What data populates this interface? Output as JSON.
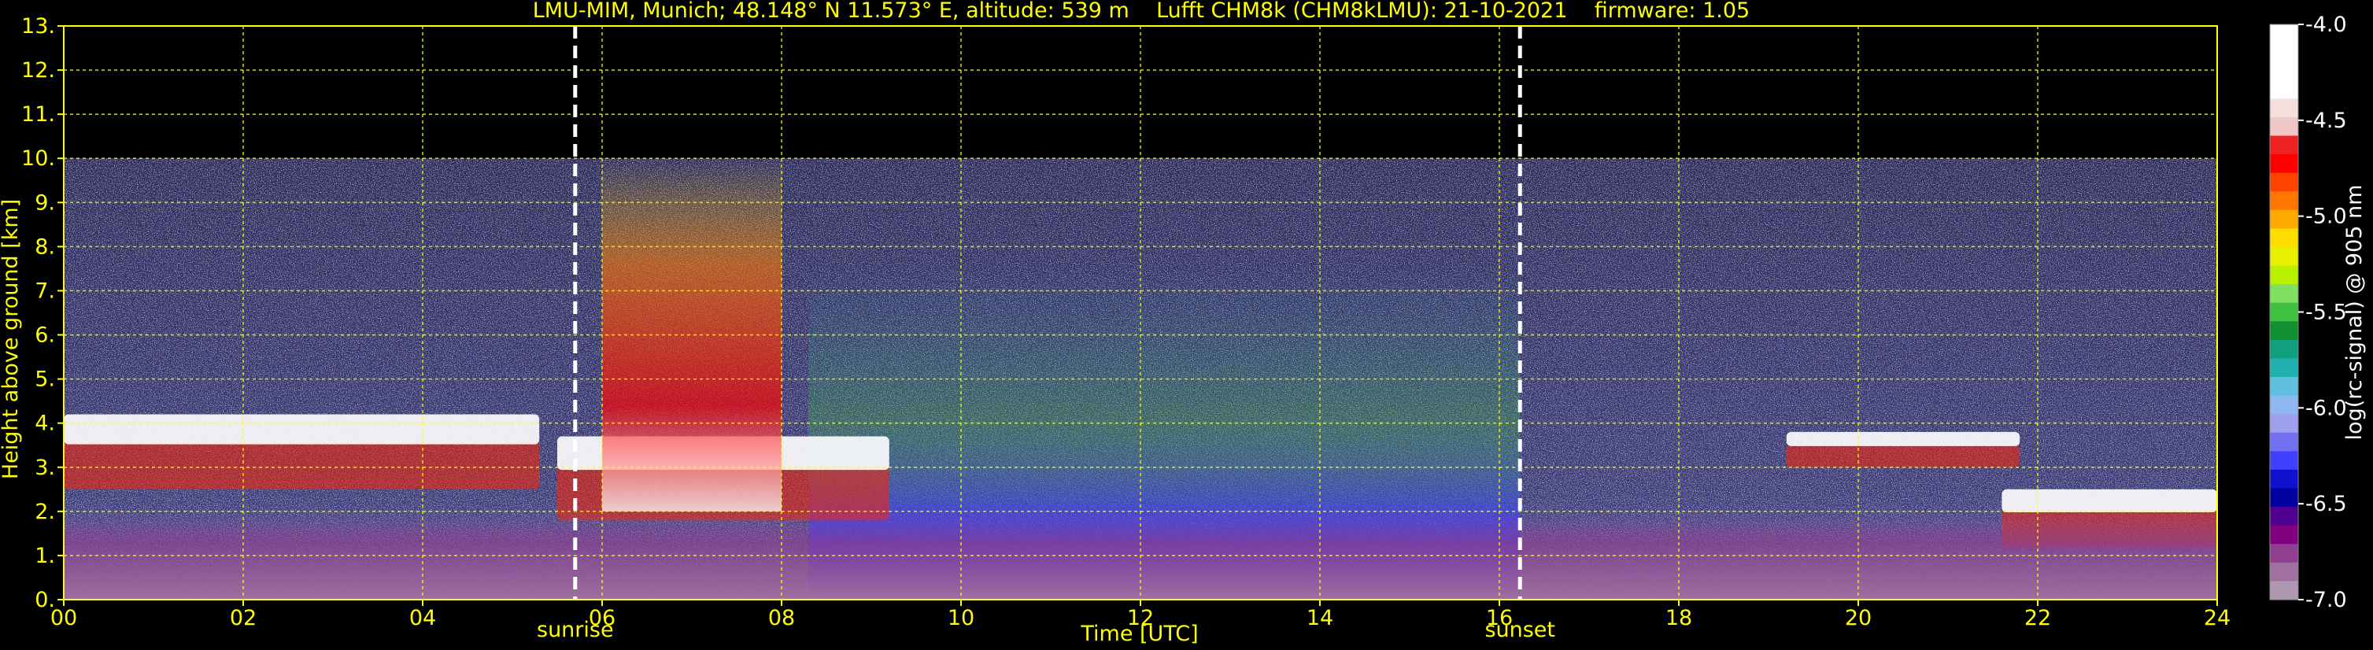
{
  "chart_data": {
    "type": "heatmap",
    "title": "LMU-MIM, Munich; 48.148° N 11.573° E, altitude: 539 m    Lufft CHM8k (CHM8kLMU): 21-10-2021    firmware: 1.05",
    "xlabel": "Time [UTC]",
    "ylabel": "Height above ground [km]",
    "xlim": [
      0,
      24
    ],
    "ylim": [
      0,
      13
    ],
    "x_ticks": [
      "00",
      "02",
      "04",
      "06",
      "08",
      "10",
      "12",
      "14",
      "16",
      "18",
      "20",
      "22",
      "24"
    ],
    "y_ticks": [
      "0.",
      "1.",
      "2.",
      "3.",
      "4.",
      "5.",
      "6.",
      "7.",
      "8.",
      "9.",
      "10.",
      "11.",
      "12.",
      "13."
    ],
    "grid": true,
    "grid_color": "#ffff00",
    "text_color": "#ffff00",
    "background": "#000000",
    "data_top_km": 10,
    "markers": [
      {
        "label": "sunrise",
        "x": 5.7
      },
      {
        "label": "sunset",
        "x": 16.23
      }
    ],
    "colorbar": {
      "label": "log(rc-signal) @ 905 nm",
      "range": [
        -7.0,
        -4.0
      ],
      "ticks": [
        "-4.0",
        "-4.5",
        "-5.0",
        "-5.5",
        "-6.0",
        "-6.5",
        "-7.0"
      ],
      "colors": [
        "#ffffff",
        "#ffffff",
        "#ffffff",
        "#ffffff",
        "#f4dede",
        "#f0c8c8",
        "#ee2222",
        "#ff0000",
        "#ff4400",
        "#ff7700",
        "#ffaa00",
        "#ffdd00",
        "#e8f000",
        "#b8f000",
        "#80e060",
        "#40c040",
        "#109030",
        "#10a080",
        "#20b0b0",
        "#60c0e0",
        "#90b8f0",
        "#a0a0f0",
        "#7070f0",
        "#4040ff",
        "#1010d0",
        "#0000a0",
        "#500090",
        "#800080",
        "#904090",
        "#a070a0",
        "#b098b0"
      ]
    },
    "features": [
      {
        "name": "noise background",
        "x": [
          0,
          24
        ],
        "y": [
          0,
          10
        ]
      },
      {
        "name": "cloud layer",
        "x": [
          0,
          5.3
        ],
        "y": [
          2.5,
          4.2
        ]
      },
      {
        "name": "cloud layer",
        "x": [
          5.5,
          9.2
        ],
        "y": [
          1.8,
          3.7
        ]
      },
      {
        "name": "elevated aerosol",
        "x": [
          6.0,
          8.0
        ],
        "y": [
          2,
          10
        ]
      },
      {
        "name": "cloud layer",
        "x": [
          19.2,
          21.8
        ],
        "y": [
          3.0,
          3.8
        ]
      },
      {
        "name": "cloud layer",
        "x": [
          21.6,
          24
        ],
        "y": [
          1.2,
          2.5
        ]
      },
      {
        "name": "boundary layer",
        "x": [
          0,
          24
        ],
        "y": [
          0,
          2
        ]
      }
    ]
  }
}
